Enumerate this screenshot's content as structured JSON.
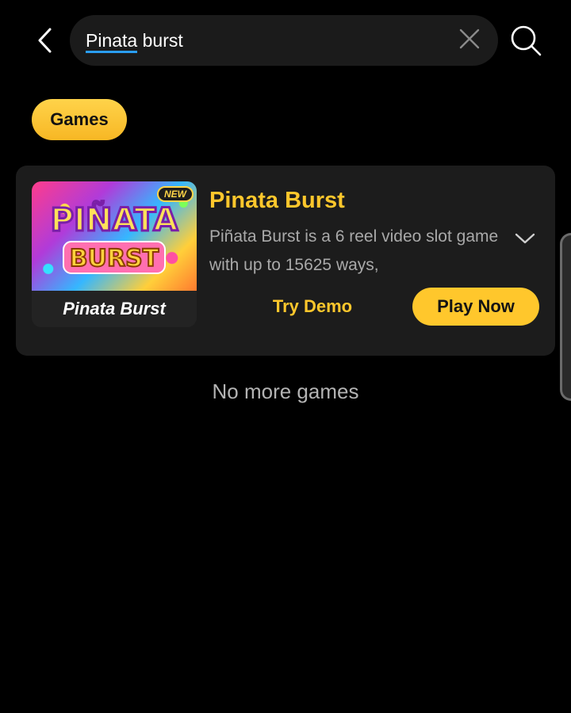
{
  "search": {
    "query_highlight": "Pinata",
    "query_rest": " burst",
    "value": "Pinata burst"
  },
  "icons": {
    "back": "chevron-left-icon",
    "clear": "close-icon",
    "search": "search-icon",
    "expand": "chevron-down-icon"
  },
  "chip": {
    "label": "Games"
  },
  "game": {
    "badge": "NEW",
    "thumb_caption": "Pinata Burst",
    "title": "Pinata Burst",
    "description": "Piñata Burst is a 6 reel video slot game with up to 15625 ways,",
    "try_demo_label": "Try Demo",
    "play_now_label": "Play Now"
  },
  "footer": {
    "no_more": "No more games"
  },
  "colors": {
    "background": "#000000",
    "accent": "#ffc72c",
    "card": "#1c1c1c",
    "search_bg": "#1b1b1b",
    "text_muted": "#a9a9a9",
    "highlight_underline": "#2a9df4"
  }
}
